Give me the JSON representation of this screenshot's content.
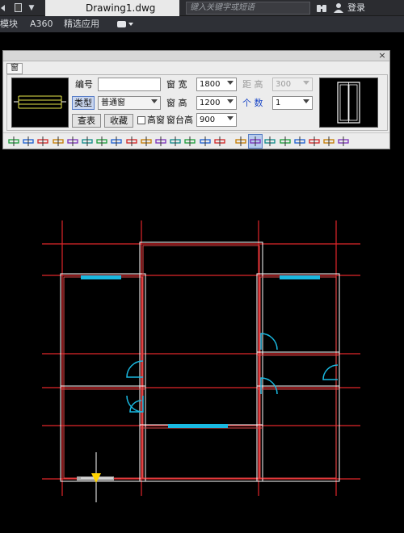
{
  "titlebar": {
    "document_title": "Drawing1.dwg",
    "search_placeholder": "键入关键字或短语",
    "login_label": "登录"
  },
  "menubar": {
    "items": [
      {
        "label": "模块"
      },
      {
        "label": "A360"
      },
      {
        "label": "精选应用"
      }
    ]
  },
  "dialog": {
    "tab_label": "窗",
    "labels": {
      "number": "编号",
      "type_button": "类型",
      "lookup_button": "查表",
      "collect_button": "收藏",
      "high_window_checkbox": "高窗",
      "window_width": "窗 宽",
      "window_height": "窗 高",
      "sill_height": "窗台高",
      "distance": "距 高",
      "count": "个 数"
    },
    "values": {
      "number": "",
      "type": "普通窗",
      "window_width": "1800",
      "window_height": "1200",
      "sill_height": "900",
      "distance": "300",
      "count": "1"
    },
    "high_window_checked": false
  },
  "toolbar_icons": [
    "insert-freely-icon",
    "insert-along-wall-icon",
    "insert-equal-split-icon",
    "insert-center-icon",
    "insert-at-corner-icon",
    "insert-by-axis-icon",
    "insert-by-wall-endpoint-icon",
    "insert-full-wall-icon",
    "insert-at-position-icon",
    "insert-door-window-icon",
    "insert-arc-wall-icon",
    "insert-trapezoid-icon",
    "insert-pen-icon",
    "insert-pick-icon",
    "insert-side-icon",
    "door-icon",
    "window-icon",
    "door-window-icon",
    "arc-window-icon",
    "arch-icon",
    "bay-window-icon",
    "hole-icon",
    "corner-window-icon"
  ],
  "colors": {
    "axis_line": "#e0262a",
    "wall_line": "#ffffff",
    "wall_inner": "#e04848",
    "window_cyan": "#19b8e0",
    "selected_yellow": "#ffd400",
    "dialog_bg": "#ececec",
    "titlebar_bg": "#2b2c30"
  }
}
